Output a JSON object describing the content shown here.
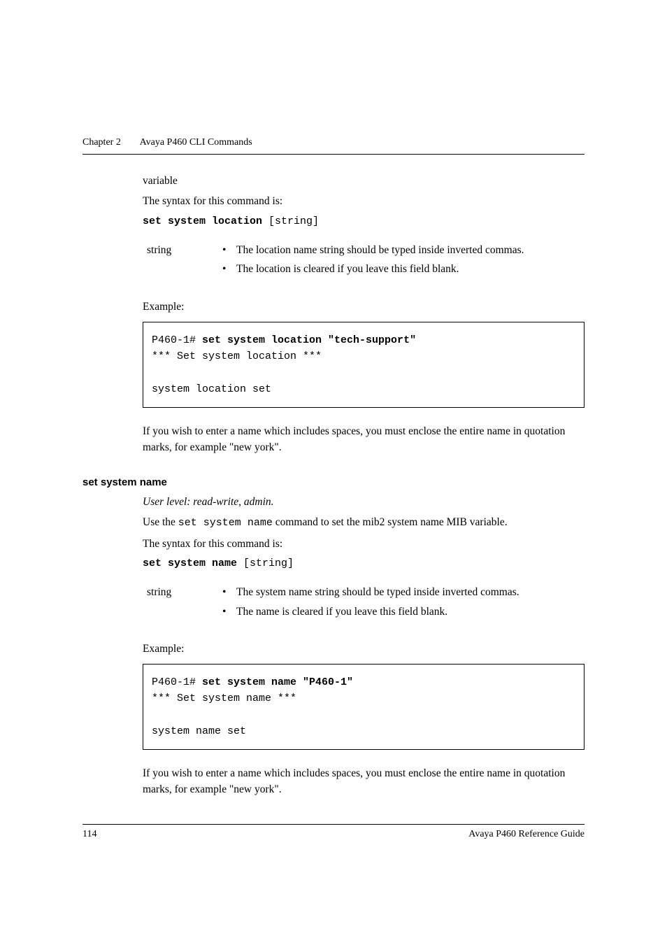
{
  "header": {
    "chapter": "Chapter 2",
    "title": "Avaya P460 CLI Commands"
  },
  "section1": {
    "variable_line": "variable",
    "syntax_intro": "The syntax for this command is:",
    "syntax_cmd_bold": "set system location",
    "syntax_cmd_rest": " [string]",
    "param_name": "string",
    "param_bullets": [
      "The location name string should be typed inside inverted commas.",
      "The location is cleared if you leave this field blank."
    ],
    "example_label": "Example:",
    "code_prompt": "P460-1# ",
    "code_cmd": "set system location \"tech-support\"",
    "code_line2": "*** Set system location ***",
    "code_line3": "system location set",
    "note": "If you wish to enter a name which includes spaces, you must enclose the entire name in quotation marks, for example \"new york\"."
  },
  "section2": {
    "heading": "set system name",
    "user_level": "User level: read-write, admin.",
    "use_pre": "Use the ",
    "use_cmd": "set system name",
    "use_post": " command to set the mib2 system name MIB variable.",
    "syntax_intro": "The syntax for this command is:",
    "syntax_cmd_bold": "set system name",
    "syntax_cmd_rest": " [string]",
    "param_name": "string",
    "param_bullets": [
      "The system name string should be typed inside inverted commas.",
      "The name is cleared if you leave this field blank."
    ],
    "example_label": "Example:",
    "code_prompt": "P460-1# ",
    "code_cmd": "set system name \"P460-1\"",
    "code_line2": "*** Set system name ***",
    "code_line3": "system name set",
    "note": "If you wish to enter a name which includes spaces, you must enclose the entire name in quotation marks, for example \"new york\"."
  },
  "footer": {
    "page_number": "114",
    "doc_title": "Avaya P460 Reference Guide"
  }
}
